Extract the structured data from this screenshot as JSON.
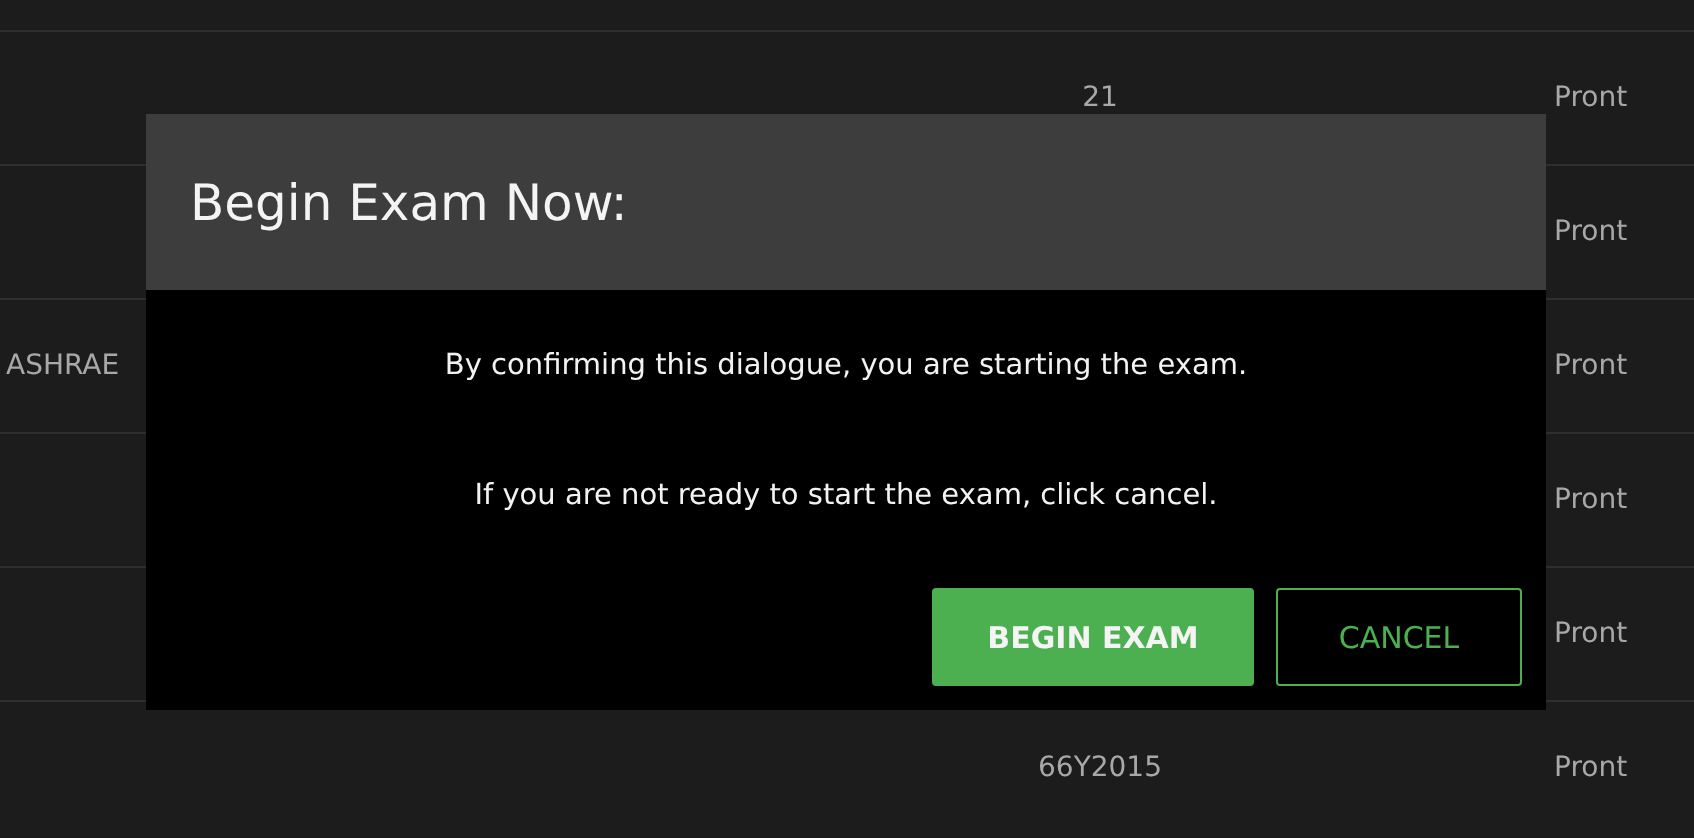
{
  "table": {
    "rows": [
      {
        "column_2": "21",
        "column_3": "Pront"
      },
      {
        "column_3": "Pront"
      },
      {
        "column_1": "ASHRAE",
        "column_3": "Pront"
      },
      {
        "column_3": "Pront"
      },
      {
        "column_3": "Pront"
      },
      {
        "column_2": "66Y2015",
        "column_3": "Pront"
      }
    ]
  },
  "dialog": {
    "title": "Begin Exam Now:",
    "messages": [
      "By confirming this dialogue, you are starting the exam.",
      "If you are not ready to start the exam, click cancel."
    ],
    "buttons": [
      {
        "label": "BEGIN EXAM",
        "kind": "primary"
      },
      {
        "label": "CANCEL",
        "kind": "outline"
      }
    ]
  }
}
